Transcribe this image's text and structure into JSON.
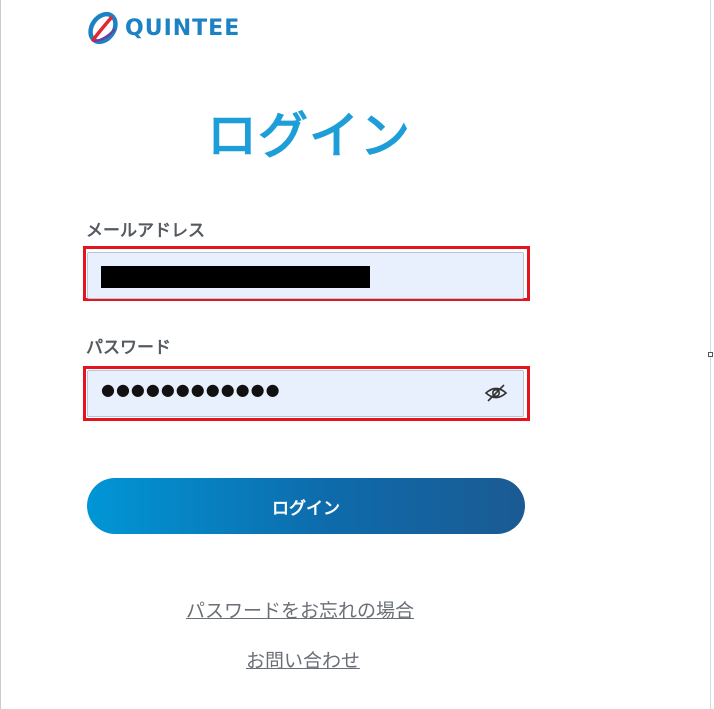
{
  "brand": {
    "name": "QUINTEE",
    "icon": "quintee-logo-icon",
    "color": "#1d82c4"
  },
  "page": {
    "title": "ログイン",
    "title_color": "#1e9ed8"
  },
  "form": {
    "email_label": "メールアドレス",
    "email_value": "",
    "email_redacted": true,
    "password_label": "パスワード",
    "password_masked": "●●●●●●●●●●●●",
    "password_toggle_icon": "eye-off-icon",
    "highlight_color": "#e3141e"
  },
  "actions": {
    "login_button": "ログイン",
    "forgot_password_link": "パスワードをお忘れの場合",
    "contact_link": "お問い合わせ"
  }
}
